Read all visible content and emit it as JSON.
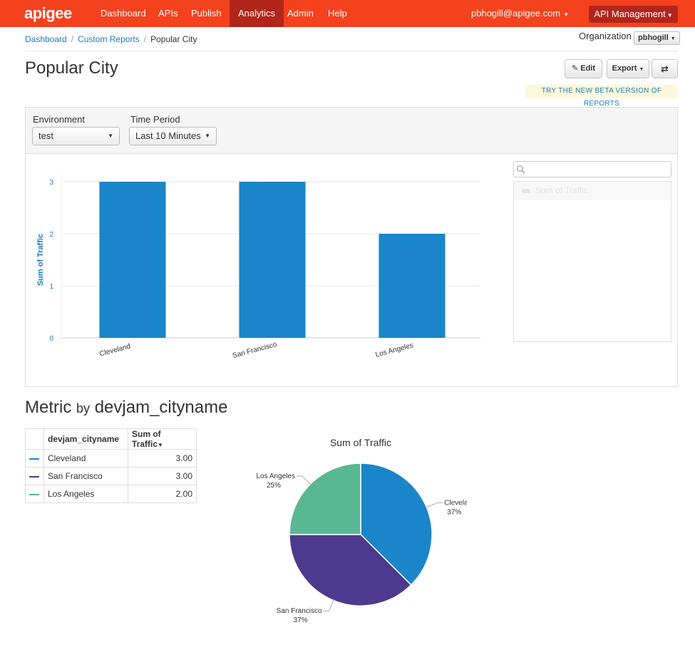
{
  "nav": {
    "logo": "apigee",
    "items": [
      "Dashboard",
      "APIs",
      "Publish",
      "Analytics",
      "Admin",
      "Help"
    ],
    "active": "Analytics",
    "user": "pbhogill@apigee.com",
    "product": "API Management"
  },
  "breadcrumb": {
    "items": [
      "Dashboard",
      "Custom Reports"
    ],
    "current": "Popular City"
  },
  "org": {
    "label": "Organization",
    "value": "pbhogill"
  },
  "page": {
    "title": "Popular City"
  },
  "actions": {
    "edit": "Edit",
    "export": "Export",
    "beta": "TRY THE NEW BETA VERSION OF REPORTS"
  },
  "filters": {
    "environment_label": "Environment",
    "environment_value": "test",
    "period_label": "Time Period",
    "period_value": "Last 10 Minutes"
  },
  "legend": {
    "items": [
      "Sum of Traffic"
    ]
  },
  "colors": {
    "bar": "#1a85c8",
    "nav": "#f4411e",
    "nav_active": "#b2251a",
    "link": "#1a7bbf"
  },
  "chart_data": [
    {
      "type": "bar",
      "categories": [
        "Cleveland",
        "San Francisco",
        "Los Angeles"
      ],
      "series": [
        {
          "name": "Sum of Traffic",
          "values": [
            3,
            3,
            2
          ]
        }
      ],
      "ylabel": "Sum of Traffic",
      "yticks": [
        0,
        1,
        2,
        3
      ],
      "ylim": [
        0,
        3
      ],
      "grid": true
    },
    {
      "type": "pie",
      "title": "Sum of Traffic",
      "labels": [
        "Cleveland",
        "San Francisco",
        "Los Angeles"
      ],
      "values": [
        3,
        3,
        2
      ],
      "percent_labels": [
        "37%",
        "37%",
        "25%"
      ],
      "colors": [
        "#1a85c8",
        "#4c3a8e",
        "#58b894"
      ]
    }
  ],
  "section": {
    "title_metric": "Metric",
    "title_by": "by",
    "title_dim": "devjam_cityname"
  },
  "table": {
    "headers": [
      "devjam_cityname",
      "Sum of Traffic"
    ],
    "rows": [
      {
        "color": "#1a85c8",
        "name": "Cleveland",
        "value": "3.00"
      },
      {
        "color": "#4c3a8e",
        "name": "San Francisco",
        "value": "3.00"
      },
      {
        "color": "#58b894",
        "name": "Los Angeles",
        "value": "2.00"
      }
    ]
  }
}
